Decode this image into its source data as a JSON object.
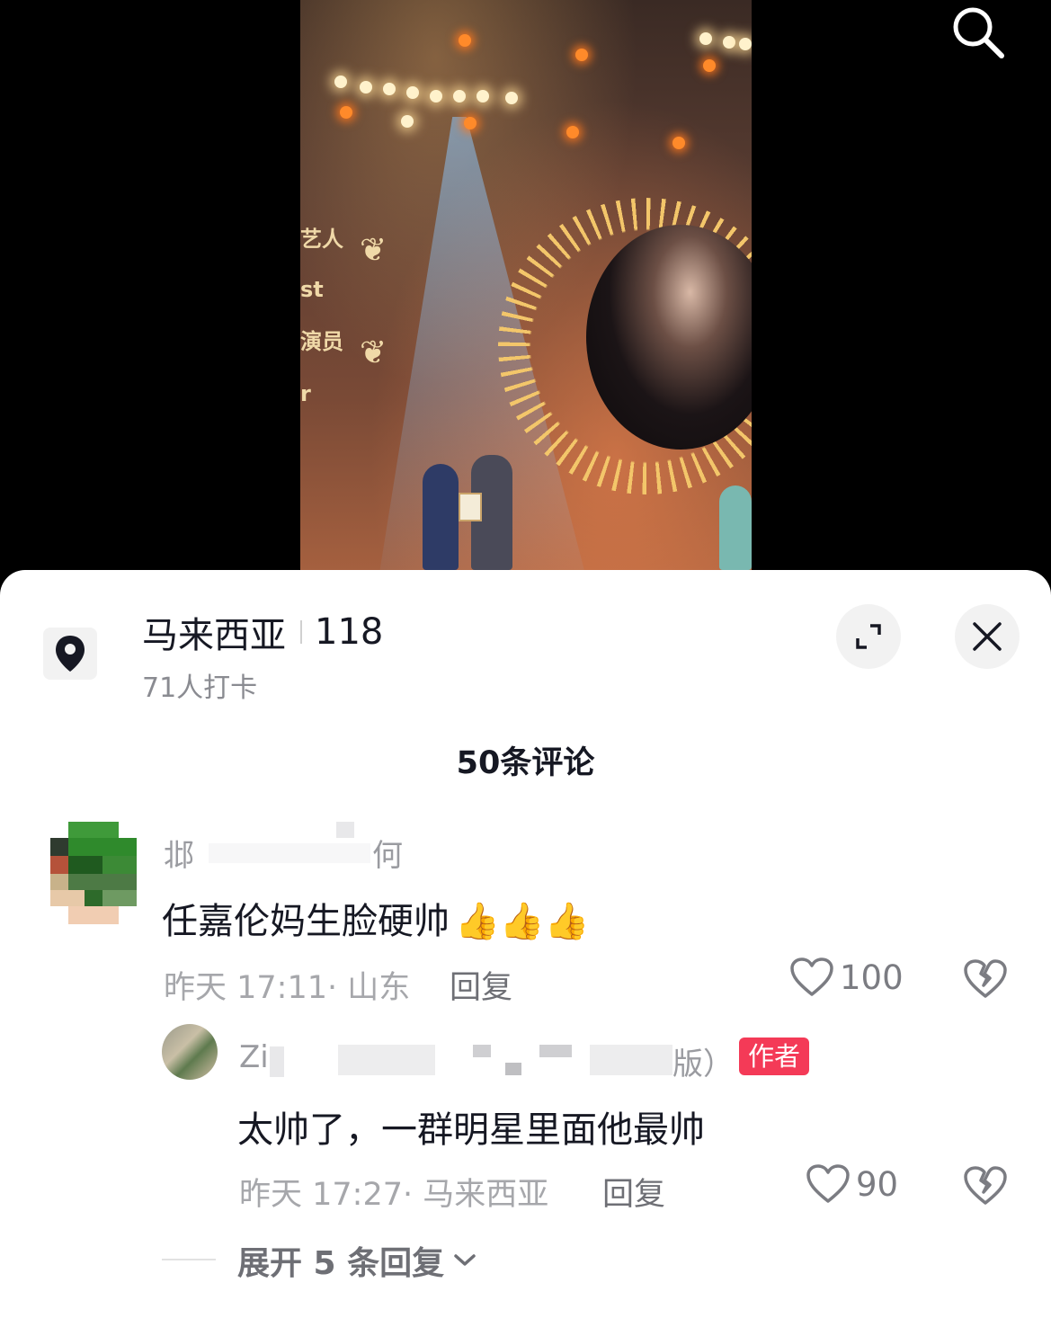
{
  "video": {
    "award_lines": [
      "艺人",
      "st",
      "演员",
      "r"
    ]
  },
  "location": {
    "name": "马来西亚",
    "count": "118",
    "checkins": "71人打卡"
  },
  "comments_header": "50条评论",
  "comments": [
    {
      "username_start": "邶",
      "username_end": "何",
      "text": "任嘉伦妈生脸硬帅",
      "emoji": "👍👍👍",
      "meta": "昨天 17:11· 山东",
      "reply_label": "回复",
      "likes": "100"
    }
  ],
  "reply": {
    "username_start": "Zi",
    "username_end": "版）",
    "badge": "作者",
    "text": "太帅了，一群明星里面他最帅",
    "meta": "昨天 17:27· 马来西亚",
    "reply_label": "回复",
    "likes": "90"
  },
  "expand_replies": "展开 5 条回复",
  "colors": {
    "badge": "#f43a57",
    "text_primary": "#161823",
    "text_secondary": "#a6a7ab"
  },
  "icons": [
    "search-icon",
    "location-pin-icon",
    "expand-icon",
    "close-icon",
    "heart-icon",
    "broken-heart-icon",
    "chevron-down-icon"
  ]
}
